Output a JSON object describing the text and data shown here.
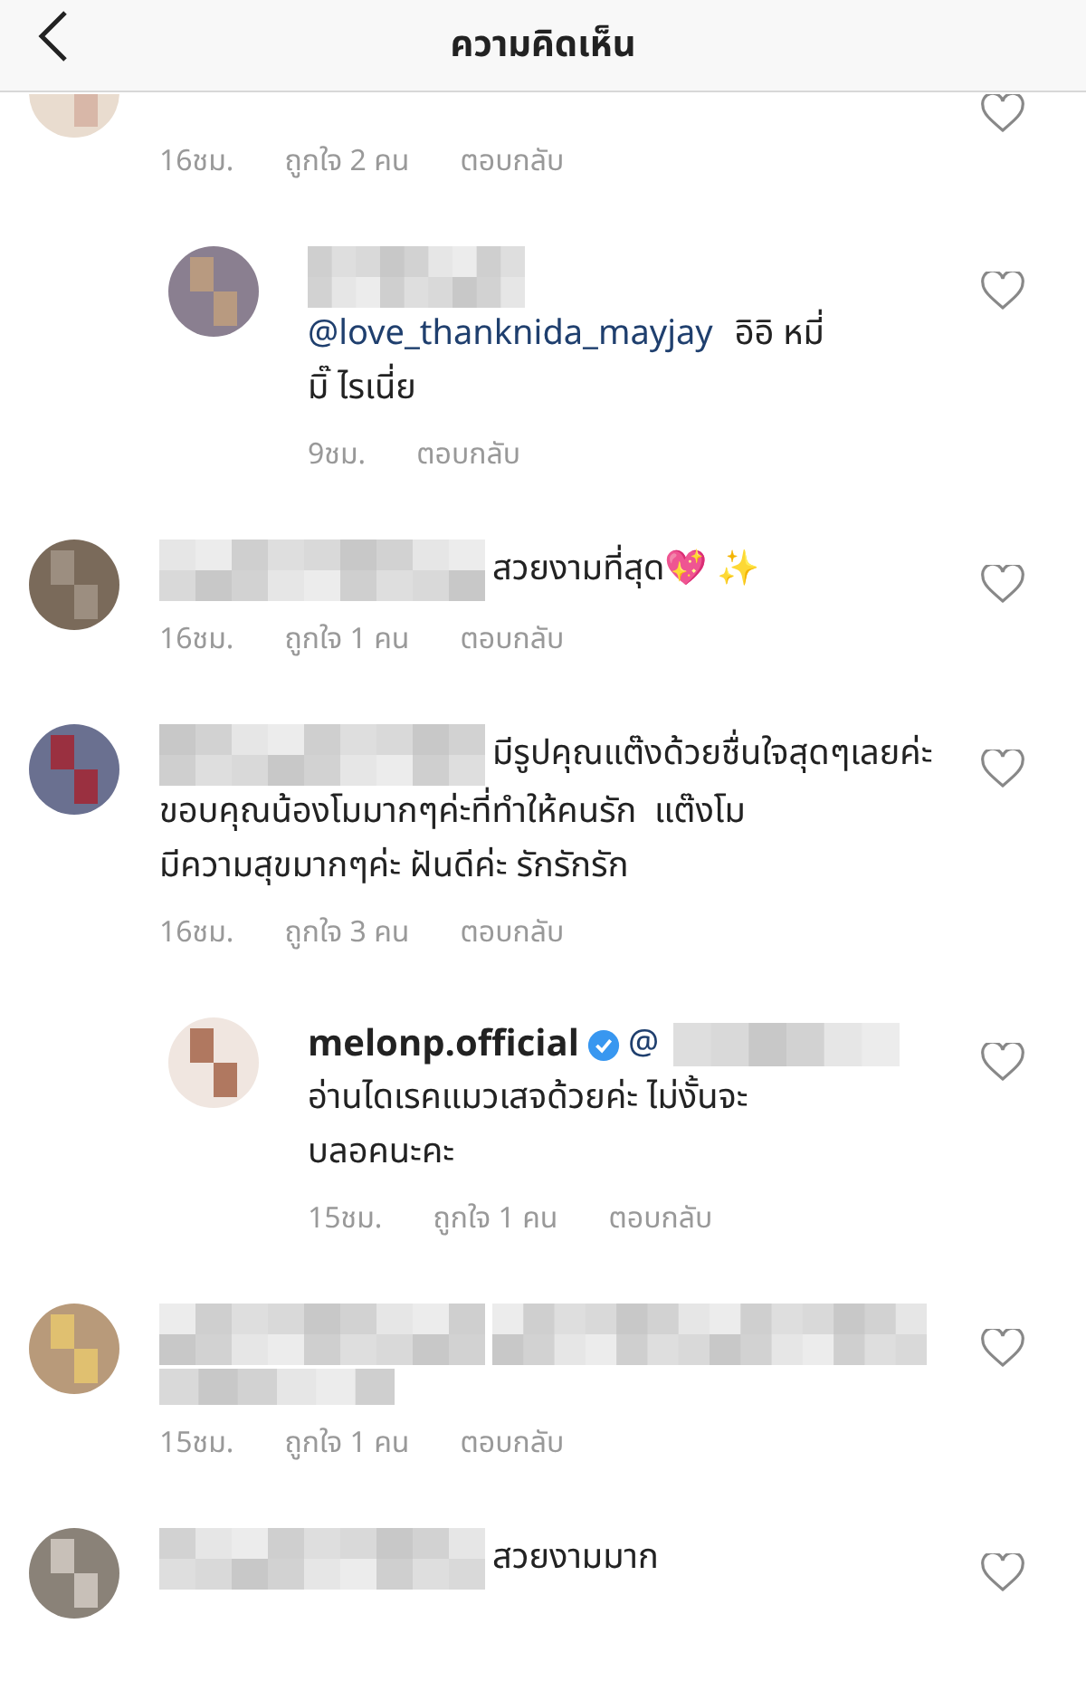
{
  "header": {
    "title": "ความคิดเห็น"
  },
  "comments": [
    {
      "kind": "comment",
      "cut_top": true,
      "time": "16ชม.",
      "likes": "ถูกใจ 2 คน",
      "reply": "ตอบกลับ",
      "liked": false
    },
    {
      "kind": "reply",
      "username_hidden": true,
      "mention": "@love_thanknida_mayjay",
      "lines": [
        "อิอิ หมี่",
        "มิ๊ ไรเนี่ย"
      ],
      "time": "9ชม.",
      "reply": "ตอบกลับ",
      "liked": false
    },
    {
      "kind": "comment",
      "username_hidden": true,
      "lines": [
        "สวยงามที่สุด💖 ✨"
      ],
      "time": "16ชม.",
      "likes": "ถูกใจ 1 คน",
      "reply": "ตอบกลับ",
      "liked": false
    },
    {
      "kind": "comment",
      "username_hidden": true,
      "lines": [
        "มีรูปคุณแต๊งด้วยชื่นใจสุดๆเลยค่ะ",
        "ขอบคุณน้องโมมากๆค่ะที่ทำให้คนรัก  แต๊งโม",
        "มีความสุขมากๆค่ะ ฝันดีค่ะ รักรักรัก"
      ],
      "time": "16ชม.",
      "likes": "ถูกใจ 3 คน",
      "reply": "ตอบกลับ",
      "liked": false
    },
    {
      "kind": "reply",
      "username": "melonp.official",
      "verified": true,
      "mention": "@",
      "mention_hidden": true,
      "lines": [
        "อ่านไดเรคแมวเสจด้วยค่ะ ไม่งั้นจะ",
        "บลอคนะคะ"
      ],
      "time": "15ชม.",
      "likes": "ถูกใจ 1 คน",
      "reply": "ตอบกลับ",
      "liked": false
    },
    {
      "kind": "comment",
      "username_hidden": true,
      "text_hidden": true,
      "time": "15ชม.",
      "likes": "ถูกใจ 1 คน",
      "reply": "ตอบกลับ",
      "liked": false
    },
    {
      "kind": "comment",
      "username_hidden": true,
      "lines": [
        "สวยงามมาก"
      ],
      "liked": false
    }
  ]
}
